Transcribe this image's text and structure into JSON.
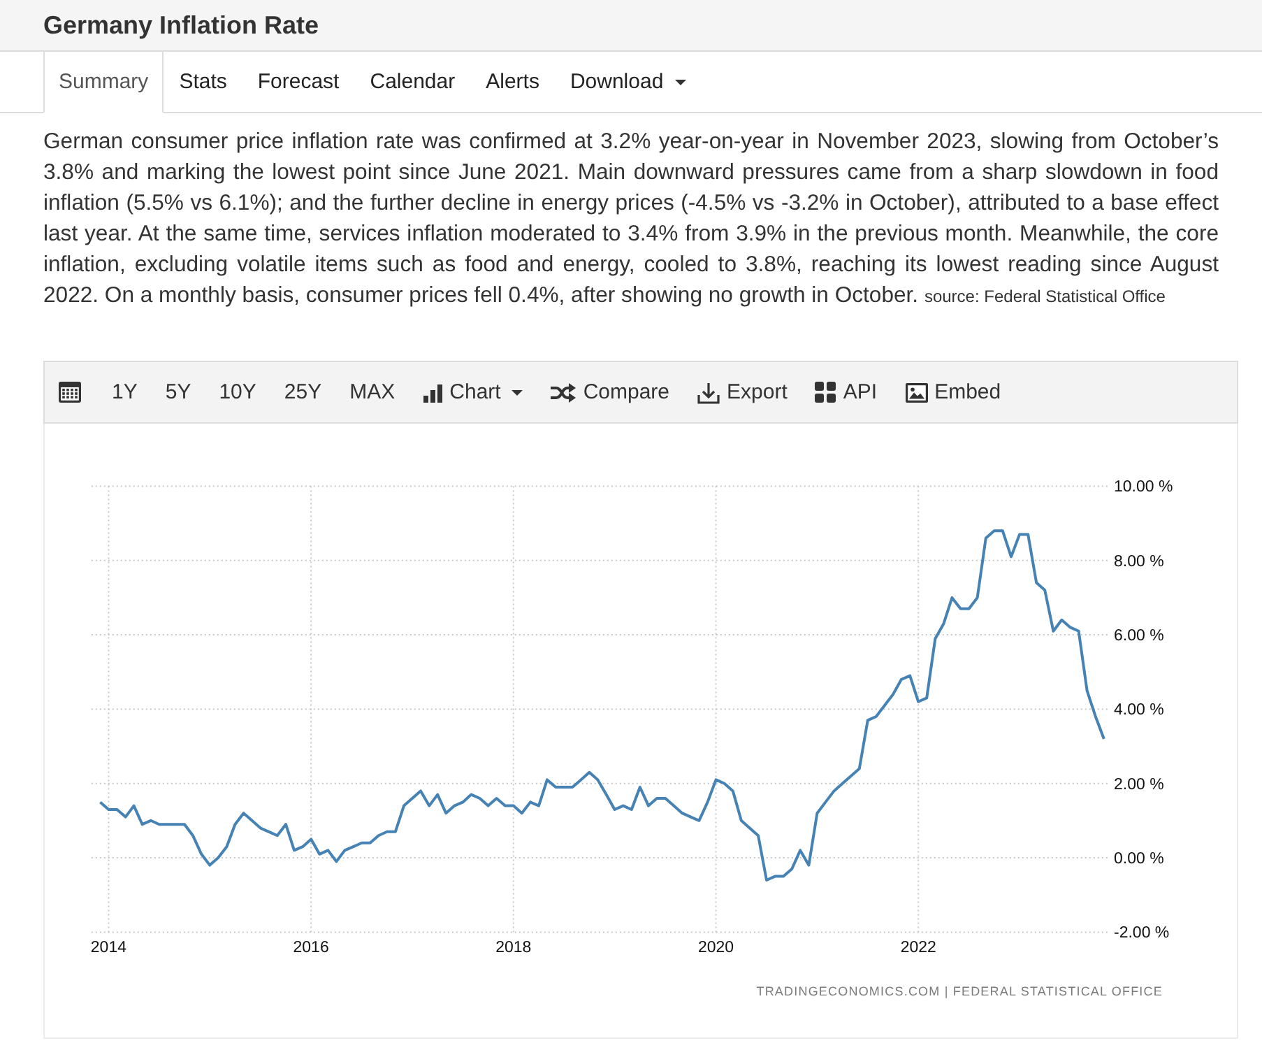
{
  "page": {
    "title": "Germany Inflation Rate"
  },
  "tabs": [
    {
      "label": "Summary",
      "selected": true,
      "dropdown": false
    },
    {
      "label": "Stats",
      "selected": false,
      "dropdown": false
    },
    {
      "label": "Forecast",
      "selected": false,
      "dropdown": false
    },
    {
      "label": "Calendar",
      "selected": false,
      "dropdown": false
    },
    {
      "label": "Alerts",
      "selected": false,
      "dropdown": false
    },
    {
      "label": "Download",
      "selected": false,
      "dropdown": true
    }
  ],
  "summary": {
    "text": "German consumer price inflation rate was confirmed at 3.2% year-on-year in November 2023, slowing from October’s 3.8% and marking the lowest point since June 2021. Main downward pressures came from a sharp slowdown in food inflation (5.5% vs 6.1%); and the further decline in energy prices (-4.5% vs -3.2% in October), attributed to a base effect last year. At the same time, services inflation moderated to 3.4% from 3.9% in the previous month. Meanwhile, the core inflation, excluding volatile items such as food and energy, cooled to 3.8%, reaching its lowest reading since August 2022. On a monthly basis, consumer prices fell 0.4%, after showing no growth in October.",
    "source": "source: Federal Statistical Office"
  },
  "chart": {
    "toolbar": [
      {
        "kind": "calendar",
        "dropdown": false
      },
      {
        "kind": "range",
        "label": "1Y",
        "dropdown": false
      },
      {
        "kind": "range",
        "label": "5Y",
        "dropdown": false
      },
      {
        "kind": "range",
        "label": "10Y",
        "dropdown": false
      },
      {
        "kind": "range",
        "label": "25Y",
        "dropdown": false
      },
      {
        "kind": "range",
        "label": "MAX",
        "dropdown": false
      },
      {
        "kind": "chart",
        "label": "Chart",
        "dropdown": true
      },
      {
        "kind": "compare",
        "label": "Compare",
        "dropdown": false
      },
      {
        "kind": "export",
        "label": "Export",
        "dropdown": false
      },
      {
        "kind": "api",
        "label": "API",
        "dropdown": false
      },
      {
        "kind": "embed",
        "label": "Embed",
        "dropdown": false
      }
    ],
    "chart_data": {
      "type": "line",
      "grid": true,
      "x": [
        2013.917,
        2014,
        2014.083,
        2014.167,
        2014.25,
        2014.333,
        2014.417,
        2014.5,
        2014.583,
        2014.667,
        2014.75,
        2014.833,
        2014.917,
        2015,
        2015.083,
        2015.167,
        2015.25,
        2015.333,
        2015.417,
        2015.5,
        2015.583,
        2015.667,
        2015.75,
        2015.833,
        2015.917,
        2016,
        2016.083,
        2016.167,
        2016.25,
        2016.333,
        2016.417,
        2016.5,
        2016.583,
        2016.667,
        2016.75,
        2016.833,
        2016.917,
        2017,
        2017.083,
        2017.167,
        2017.25,
        2017.333,
        2017.417,
        2017.5,
        2017.583,
        2017.667,
        2017.75,
        2017.833,
        2017.917,
        2018,
        2018.083,
        2018.167,
        2018.25,
        2018.333,
        2018.417,
        2018.5,
        2018.583,
        2018.667,
        2018.75,
        2018.833,
        2018.917,
        2019,
        2019.083,
        2019.167,
        2019.25,
        2019.333,
        2019.417,
        2019.5,
        2019.583,
        2019.667,
        2019.75,
        2019.833,
        2019.917,
        2020,
        2020.083,
        2020.167,
        2020.25,
        2020.333,
        2020.417,
        2020.5,
        2020.583,
        2020.667,
        2020.75,
        2020.833,
        2020.917,
        2021,
        2021.083,
        2021.167,
        2021.25,
        2021.333,
        2021.417,
        2021.5,
        2021.583,
        2021.667,
        2021.75,
        2021.833,
        2021.917,
        2022,
        2022.083,
        2022.167,
        2022.25,
        2022.333,
        2022.417,
        2022.5,
        2022.583,
        2022.667,
        2022.75,
        2022.833,
        2022.917,
        2023,
        2023.083,
        2023.167,
        2023.25,
        2023.333,
        2023.417,
        2023.5,
        2023.583,
        2023.667,
        2023.75,
        2023.833
      ],
      "series": [
        {
          "color": "#4682b4",
          "values": [
            1.5,
            1.3,
            1.3,
            1.1,
            1.4,
            0.9,
            1.0,
            0.9,
            0.9,
            0.9,
            0.9,
            0.6,
            0.1,
            -0.2,
            0.0,
            0.3,
            0.9,
            1.2,
            1.0,
            0.8,
            0.7,
            0.6,
            0.9,
            0.2,
            0.3,
            0.5,
            0.1,
            0.2,
            -0.1,
            0.2,
            0.3,
            0.4,
            0.4,
            0.6,
            0.7,
            0.7,
            1.4,
            1.6,
            1.8,
            1.4,
            1.7,
            1.2,
            1.4,
            1.5,
            1.7,
            1.6,
            1.4,
            1.6,
            1.4,
            1.4,
            1.2,
            1.5,
            1.4,
            2.1,
            1.9,
            1.9,
            1.9,
            2.1,
            2.3,
            2.1,
            1.7,
            1.3,
            1.4,
            1.3,
            1.9,
            1.4,
            1.6,
            1.6,
            1.4,
            1.2,
            1.1,
            1.0,
            1.5,
            2.1,
            2.0,
            1.8,
            1.0,
            0.8,
            0.6,
            -0.6,
            -0.5,
            -0.5,
            -0.3,
            0.2,
            -0.2,
            1.2,
            1.5,
            1.8,
            2.0,
            2.2,
            2.4,
            3.7,
            3.8,
            4.1,
            4.4,
            4.8,
            4.9,
            4.2,
            4.3,
            5.9,
            6.3,
            7.0,
            6.7,
            6.7,
            7.0,
            8.6,
            8.8,
            8.8,
            8.1,
            8.7,
            8.7,
            7.4,
            7.2,
            6.1,
            6.4,
            6.2,
            6.1,
            4.5,
            3.8,
            3.2
          ]
        }
      ],
      "xlim": [
        2013.83,
        2023.89
      ],
      "ylim": [
        -2,
        10
      ],
      "xticks": [
        2014,
        2016,
        2018,
        2020,
        2022
      ],
      "yticks": [
        {
          "value": 10,
          "label": "10.00 %"
        },
        {
          "value": 8,
          "label": "8.00 %"
        },
        {
          "value": 6,
          "label": "6.00 %"
        },
        {
          "value": 4,
          "label": "4.00 %"
        },
        {
          "value": 2,
          "label": "2.00 %"
        },
        {
          "value": 0,
          "label": "0.00 %"
        },
        {
          "value": -2,
          "label": "-2.00 %"
        }
      ]
    },
    "credit": "TRADINGECONOMICS.COM | FEDERAL STATISTICAL OFFICE"
  }
}
